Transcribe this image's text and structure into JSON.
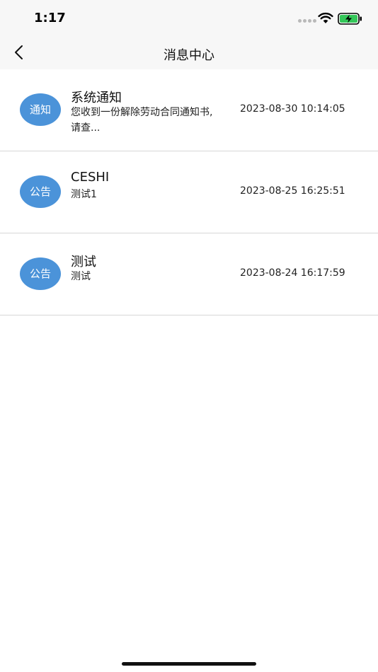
{
  "status_bar": {
    "time": "1:17"
  },
  "nav": {
    "title": "消息中心"
  },
  "messages": [
    {
      "badge": "通知",
      "title": "系统通知",
      "body": "您收到一份解除劳动合同通知书,请查...",
      "time": "2023-08-30 10:14:05"
    },
    {
      "badge": "公告",
      "title": "CESHI",
      "body": "测试1",
      "time": "2023-08-25 16:25:51"
    },
    {
      "badge": "公告",
      "title": "测试",
      "body": "测试",
      "time": "2023-08-24 16:17:59"
    }
  ],
  "colors": {
    "badge": "#4b93d9",
    "bar_bg": "#f7f7f7",
    "battery": "#34c759"
  }
}
